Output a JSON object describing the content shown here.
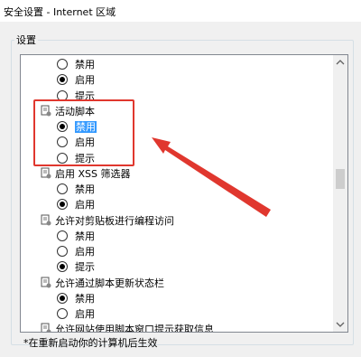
{
  "window": {
    "title": "安全设置 - Internet 区域"
  },
  "group": {
    "label": "设置"
  },
  "rows": [
    {
      "kind": "opt",
      "label": "禁用",
      "checked": false
    },
    {
      "kind": "opt",
      "label": "启用",
      "checked": true
    },
    {
      "kind": "opt",
      "label": "提示",
      "checked": false
    },
    {
      "kind": "cat",
      "label": "活动脚本"
    },
    {
      "kind": "opt",
      "label": "禁用",
      "checked": true,
      "selected": true
    },
    {
      "kind": "opt",
      "label": "启用",
      "checked": false
    },
    {
      "kind": "opt",
      "label": "提示",
      "checked": false
    },
    {
      "kind": "cat",
      "label": "启用 XSS 筛选器"
    },
    {
      "kind": "opt",
      "label": "禁用",
      "checked": false
    },
    {
      "kind": "opt",
      "label": "启用",
      "checked": true
    },
    {
      "kind": "cat",
      "label": "允许对剪贴板进行编程访问"
    },
    {
      "kind": "opt",
      "label": "禁用",
      "checked": false
    },
    {
      "kind": "opt",
      "label": "启用",
      "checked": false
    },
    {
      "kind": "opt",
      "label": "提示",
      "checked": true
    },
    {
      "kind": "cat",
      "label": "允许通过脚本更新状态栏"
    },
    {
      "kind": "opt",
      "label": "禁用",
      "checked": true
    },
    {
      "kind": "opt",
      "label": "启用",
      "checked": false
    },
    {
      "kind": "cat",
      "label": "允许网站使用脚本窗口提示获取信息"
    }
  ],
  "footnote": "*在重新启动你的计算机后生效",
  "colors": {
    "highlight": "#e0372e",
    "selection": "#3399ff"
  },
  "icons": {
    "category": "script-settings-icon",
    "scroll_up": "chevron-up-icon",
    "scroll_down": "chevron-down-icon"
  }
}
